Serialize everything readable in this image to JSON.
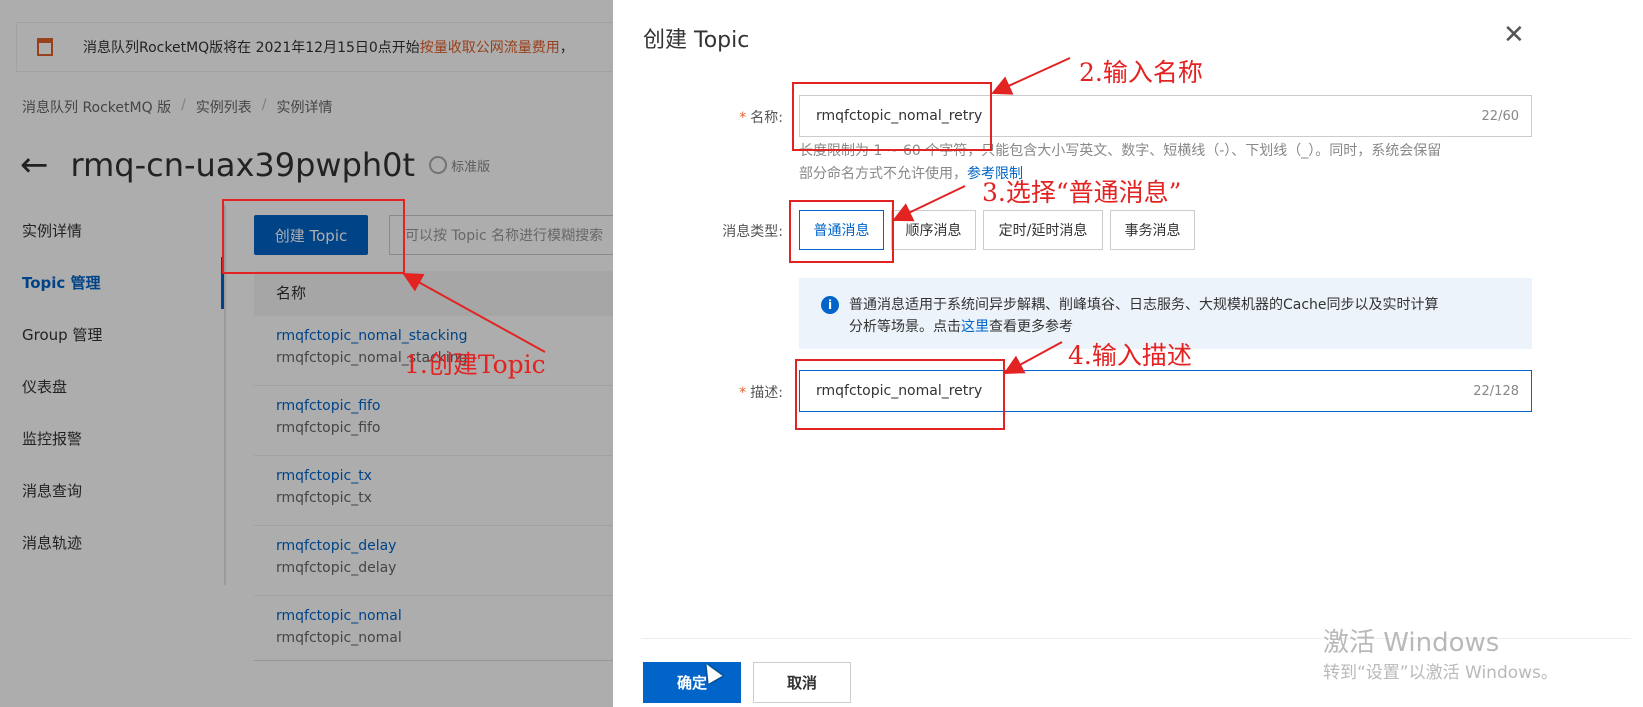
{
  "background": {
    "notice": {
      "text_before": "消息队列RocketMQ版将在 2021年12月15日0点开始",
      "highlight": "按量收取公网流量费用",
      "text_after": "，"
    },
    "breadcrumb": [
      "消息队列 RocketMQ 版",
      "实例列表",
      "实例详情"
    ],
    "breadcrumb_sep": "/",
    "instance_title": "rmq-cn-uax39pwph0t",
    "edition_badge": "标准版",
    "sidenav": [
      "实例详情",
      "Topic 管理",
      "Group 管理",
      "仪表盘",
      "监控报警",
      "消息查询",
      "消息轨迹"
    ],
    "create_button": "创建 Topic",
    "search_placeholder": "可以按 Topic 名称进行模糊搜索",
    "table_header": "名称",
    "rows": [
      {
        "name": "rmqfctopic_nomal_stacking",
        "desc": "rmqfctopic_nomal_stacking"
      },
      {
        "name": "rmqfctopic_fifo",
        "desc": "rmqfctopic_fifo"
      },
      {
        "name": "rmqfctopic_tx",
        "desc": "rmqfctopic_tx"
      },
      {
        "name": "rmqfctopic_delay",
        "desc": "rmqfctopic_delay"
      },
      {
        "name": "rmqfctopic_nomal",
        "desc": "rmqfctopic_nomal"
      }
    ]
  },
  "drawer": {
    "title": "创建 Topic",
    "close_icon": "close-icon",
    "name_label": "名称:",
    "name_value": "rmqfctopic_nomal_retry",
    "name_count": "22/60",
    "hint_line1": "长度限制为 1 ~ 60 个字符，只能包含大小写英文、数字、短横线（-）、下划线（_）。同时，系统会保留",
    "hint_line2": "部分命名方式不允许使用，",
    "hint_link": "参考限制",
    "type_label": "消息类型:",
    "types": [
      "普通消息",
      "顺序消息",
      "定时/延时消息",
      "事务消息"
    ],
    "selected_type": "普通消息",
    "info_line1": "普通消息适用于系统间异步解耦、削峰填谷、日志服务、大规模机器的Cache同步以及实时计算",
    "info_line2_before": "分析等场景。点击",
    "info_link": "这里",
    "info_line2_after": "查看更多参考",
    "desc_label": "描述:",
    "desc_value": "rmqfctopic_nomal_retry",
    "desc_count": "22/128",
    "ok_button": "确定",
    "cancel_button": "取消"
  },
  "watermark": {
    "line1": "激活 Windows",
    "line2": "转到“设置”以激活 Windows。"
  },
  "annotations": {
    "step1": "1.创建Topic",
    "step2": "2.输入名称",
    "step3": "3.选择“普通消息”",
    "step4": "4.输入描述",
    "color": "#e32222"
  },
  "colors": {
    "primary": "#0064c8",
    "warning": "#e0612c"
  }
}
